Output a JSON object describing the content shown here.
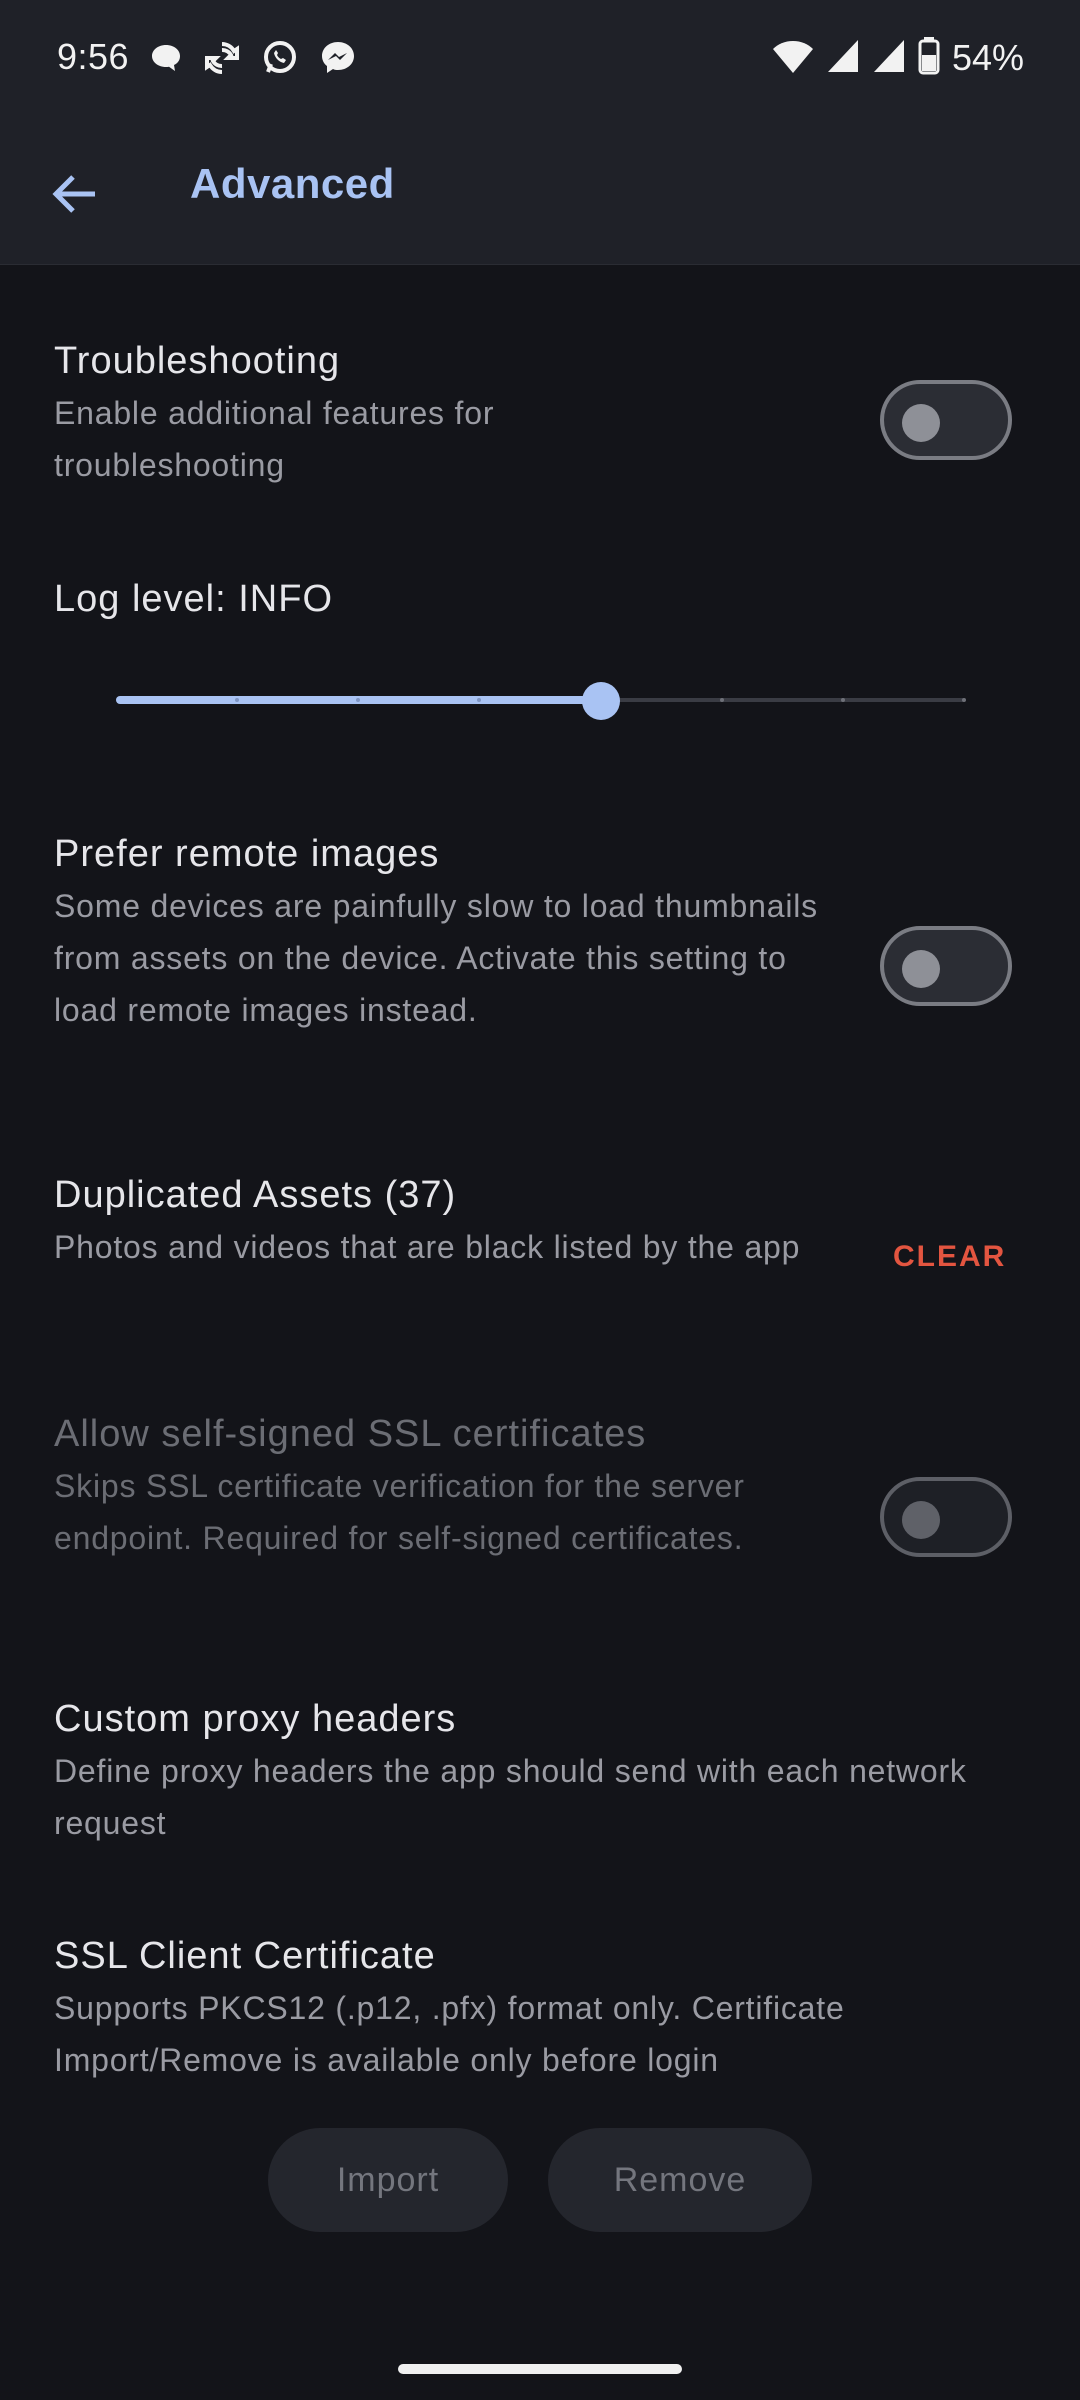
{
  "status_bar": {
    "time": "9:56",
    "battery": "54%",
    "left_icons": [
      "chat-bubble-icon",
      "sync-icon",
      "whatsapp-icon",
      "messenger-icon"
    ],
    "right_icons": [
      "wifi-icon",
      "signal-icon",
      "signal-icon",
      "battery-icon"
    ]
  },
  "app_bar": {
    "title": "Advanced",
    "back_icon": "arrow-left-icon"
  },
  "colors": {
    "accent": "#a9c3f3",
    "danger": "#e35540",
    "background": "#131419",
    "surface": "#1f2128"
  },
  "settings": {
    "troubleshooting": {
      "title": "Troubleshooting",
      "description": "Enable additional features for troubleshooting",
      "enabled": false
    },
    "log_level": {
      "title": "Log level: INFO",
      "value_index": 4,
      "steps": 7
    },
    "prefer_remote_images": {
      "title": "Prefer remote images",
      "description": "Some devices are painfully slow to load thumbnails from assets on the device. Activate this setting to load remote images instead.",
      "enabled": false
    },
    "duplicated_assets": {
      "title": "Duplicated Assets (37)",
      "description": "Photos and videos that are black listed by the app",
      "action_label": "CLEAR"
    },
    "self_signed_ssl": {
      "title": "Allow self-signed SSL certificates",
      "description": "Skips SSL certificate verification for the server endpoint. Required for self-signed certificates.",
      "enabled": false,
      "disabled": true
    },
    "custom_proxy_headers": {
      "title": "Custom proxy headers",
      "description": "Define proxy headers the app should send with each network request"
    },
    "ssl_client_certificate": {
      "title": "SSL Client Certificate",
      "description": "Supports PKCS12 (.p12, .pfx) format only. Certificate Import/Remove is available only before login",
      "import_label": "Import",
      "remove_label": "Remove"
    }
  }
}
